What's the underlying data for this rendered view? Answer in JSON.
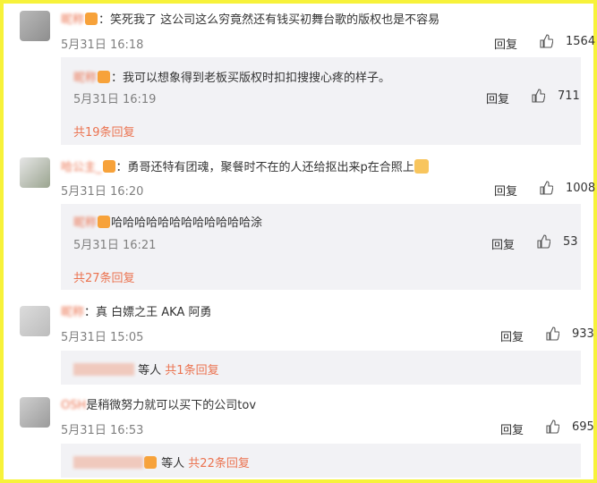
{
  "comments": [
    {
      "name": "昵称",
      "text": "：笑死我了 这公司这么穷竟然还有钱买初舞台歌的版权也是不容易",
      "time": "5月31日 16:18",
      "reply_label": "回复",
      "likes": "1564",
      "sub": {
        "name": "昵称",
        "text": "：我可以想象得到老板买版权时扣扣搜搜心疼的样子。",
        "time": "5月31日 16:19",
        "reply_label": "回复",
        "likes": "711"
      },
      "more": "共19条回复"
    },
    {
      "name": "哈公主_",
      "text": "：勇哥还特有团魂，聚餐时不在的人还给抠出来p在合照上",
      "time": "5月31日 16:20",
      "reply_label": "回复",
      "likes": "1008",
      "sub": {
        "name": "昵称",
        "text": "哈哈哈哈哈哈哈哈哈哈哈哈涂",
        "time": "5月31日 16:21",
        "reply_label": "回复",
        "likes": "53"
      },
      "more": "共27条回复"
    },
    {
      "name": "昵称",
      "text": "：真 白嫖之王 AKA 阿勇",
      "time": "5月31日 15:05",
      "reply_label": "回复",
      "likes": "933",
      "more_prefix": "等人",
      "more": "共1条回复"
    },
    {
      "name": "OSH",
      "text": "是稍微努力就可以买下的公司tov",
      "time": "5月31日 16:53",
      "reply_label": "回复",
      "likes": "695",
      "more_prefix": "等人",
      "more": "共22条回复"
    }
  ],
  "icons": {
    "like": "thumbs-up-icon",
    "badge": "vip-badge-icon"
  },
  "colors": {
    "accent": "#eb7350",
    "border": "#f7f23a",
    "sub_bg": "#f2f2f5"
  }
}
